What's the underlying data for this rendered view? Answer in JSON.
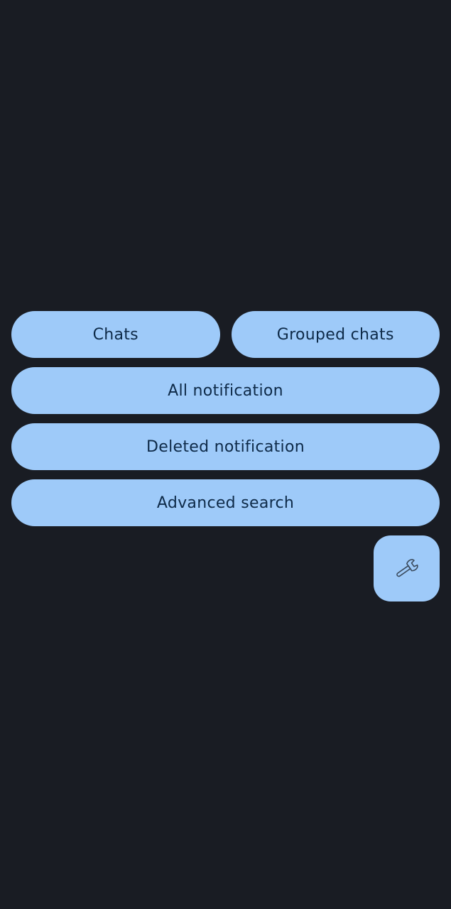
{
  "menu": {
    "chats_label": "Chats",
    "grouped_chats_label": "Grouped chats",
    "all_notification_label": "All notification",
    "deleted_notification_label": "Deleted notification",
    "advanced_search_label": "Advanced search"
  },
  "fab": {
    "icon": "wrench-icon"
  },
  "colors": {
    "background": "#191c23",
    "button": "#9ecaf9",
    "button_text": "#0e2a48"
  }
}
